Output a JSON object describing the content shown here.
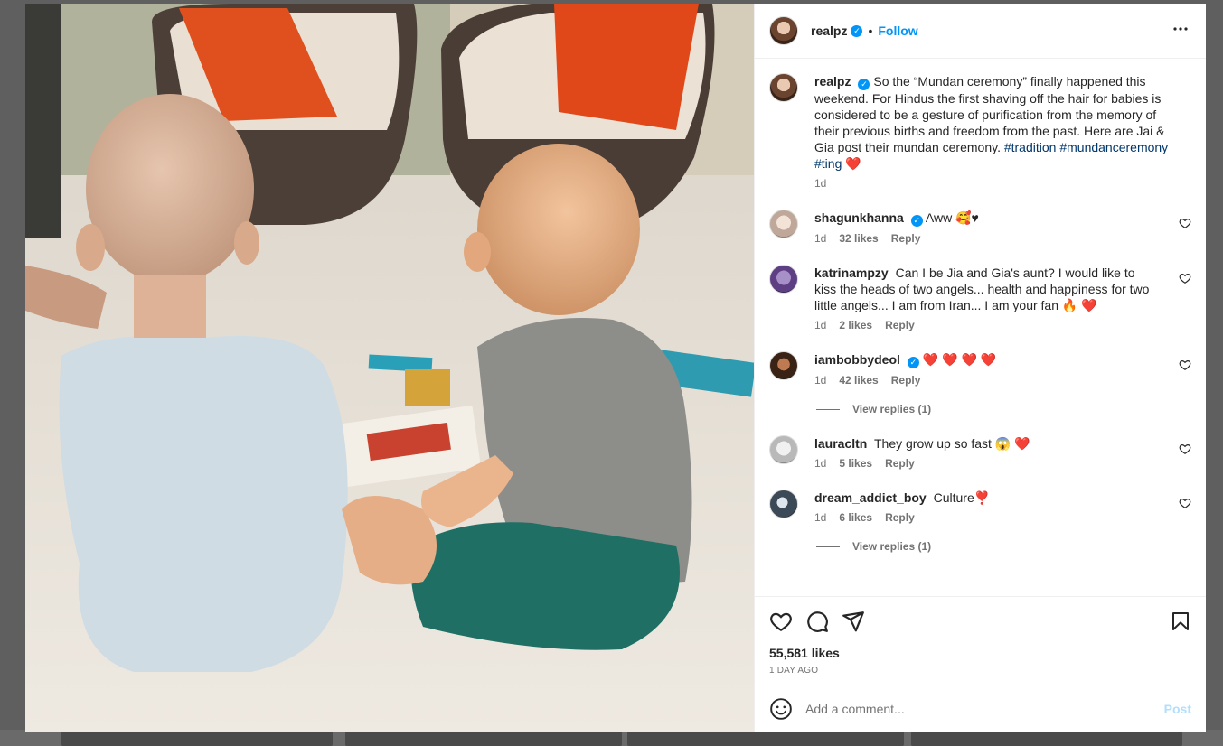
{
  "header": {
    "username": "realpz",
    "follow_label": "Follow",
    "more_label": "•••"
  },
  "caption": {
    "username": "realpz",
    "text": "So the “Mundan ceremony” finally happened this weekend. For Hindus the first shaving off the hair for babies is considered to be a gesture of purification from the memory of their previous births and freedom from the past. Here are Jai & Gia post their mundan ceremony.",
    "hashtags": [
      "#tradition",
      "#mundanceremony",
      "#ting"
    ],
    "emoji": "❤️",
    "time": "1d"
  },
  "comments": [
    {
      "username": "shagunkhanna",
      "verified": true,
      "text": "Aww 🥰♥",
      "time": "1d",
      "likes": "32 likes",
      "reply": "Reply",
      "view_replies": null
    },
    {
      "username": "katrinampzy",
      "verified": false,
      "text": "Can I be Jia and Gia's aunt? I would like to kiss the heads of two angels... health and happiness for two little angels... I am from Iran... I am your fan 🔥 ❤️",
      "time": "1d",
      "likes": "2 likes",
      "reply": "Reply",
      "view_replies": null
    },
    {
      "username": "iambobbydeol",
      "verified": true,
      "text": "❤️ ❤️ ❤️ ❤️",
      "time": "1d",
      "likes": "42 likes",
      "reply": "Reply",
      "view_replies": "View replies (1)"
    },
    {
      "username": "lauracltn",
      "verified": false,
      "text": "They grow up so fast 😱 ❤️",
      "time": "1d",
      "likes": "5 likes",
      "reply": "Reply",
      "view_replies": null
    },
    {
      "username": "dream_addict_boy",
      "verified": false,
      "text": "Culture❣️",
      "time": "1d",
      "likes": "6 likes",
      "reply": "Reply",
      "view_replies": "View replies (1)"
    }
  ],
  "actions": {
    "likes": "55,581 likes",
    "date": "1 DAY AGO"
  },
  "comment_box": {
    "placeholder": "Add a comment...",
    "post_label": "Post"
  },
  "colors": {
    "link": "#0095f6",
    "hashtag": "#00376b",
    "muted": "#737373",
    "heart": "#ed4956"
  }
}
